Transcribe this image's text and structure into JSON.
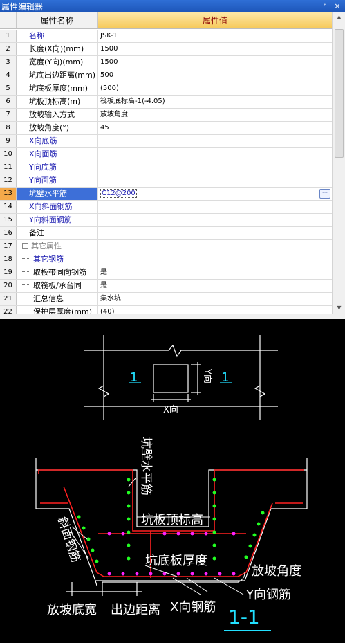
{
  "panel": {
    "title": "属性编辑器",
    "pin_glyph": "ᴾ",
    "close_glyph": "×"
  },
  "header": {
    "col_name": "属性名称",
    "col_value": "属性值"
  },
  "rows": [
    {
      "num": "1",
      "name": "名称",
      "value": "JSK-1"
    },
    {
      "num": "2",
      "name": "长度(X向)(mm)",
      "value": "1500"
    },
    {
      "num": "3",
      "name": "宽度(Y向)(mm)",
      "value": "1500"
    },
    {
      "num": "4",
      "name": "坑底出边距离(mm)",
      "value": "500"
    },
    {
      "num": "5",
      "name": "坑底板厚度(mm)",
      "value": "(500)"
    },
    {
      "num": "6",
      "name": "坑板顶标高(m)",
      "value": "筏板底标高-1(-4.05)"
    },
    {
      "num": "7",
      "name": "放坡输入方式",
      "value": "放坡角度"
    },
    {
      "num": "8",
      "name": "放坡角度(°)",
      "value": "45"
    },
    {
      "num": "9",
      "name": "X向底筋",
      "value": ""
    },
    {
      "num": "10",
      "name": "X向面筋",
      "value": ""
    },
    {
      "num": "11",
      "name": "Y向底筋",
      "value": ""
    },
    {
      "num": "12",
      "name": "Y向面筋",
      "value": ""
    },
    {
      "num": "13",
      "name": "坑壁水平筋",
      "value": "C12@200",
      "ellipsis": "···"
    },
    {
      "num": "14",
      "name": "X向斜面钢筋",
      "value": ""
    },
    {
      "num": "15",
      "name": "Y向斜面钢筋",
      "value": ""
    },
    {
      "num": "16",
      "name": "备注",
      "value": ""
    },
    {
      "num": "17",
      "name": "其它属性",
      "value": "",
      "expander": "−"
    },
    {
      "num": "18",
      "name": "其它钢筋",
      "value": ""
    },
    {
      "num": "19",
      "name": "取板带同向钢筋",
      "value": "是"
    },
    {
      "num": "20",
      "name": "取筏板/承台同",
      "value": "是"
    },
    {
      "num": "21",
      "name": "汇总信息",
      "value": "集水坑"
    },
    {
      "num": "22",
      "name": "保护层厚度(mm)",
      "value": "(40)"
    }
  ],
  "scrollbar": {
    "up_glyph": "▲",
    "down_glyph": "▼"
  },
  "drawing": {
    "plan_section_mark_left": "1",
    "plan_section_mark_right": "1",
    "label_x_dir": "X向",
    "label_y_dir": "Y向",
    "label_wall_horizontal_rebar": "坑壁水平筋",
    "label_slab_top_elevation": "坑板顶标高",
    "label_slope_rebar": "斜面钢筋",
    "label_slab_thickness": "坑底板厚度",
    "label_slope_angle": "放坡角度",
    "label_y_rebar": "Y向钢筋",
    "label_x_rebar": "X向钢筋",
    "label_slope_width": "放坡底宽",
    "label_edge_distance": "出边距离",
    "section_title": "1-1"
  },
  "colors": {
    "title_bar": "#1d55b8",
    "header_value_bg": "#f6c95a",
    "selected_row": "#3d6fd8",
    "blue_text": "#1a1ab0",
    "cad_bg": "#000000",
    "cad_line": "#ffffff",
    "cad_rebar_red": "#ff2020",
    "cad_rebar_green": "#22ff22",
    "cad_rebar_magenta": "#ff22ff",
    "cad_cyan": "#22e0ff"
  }
}
